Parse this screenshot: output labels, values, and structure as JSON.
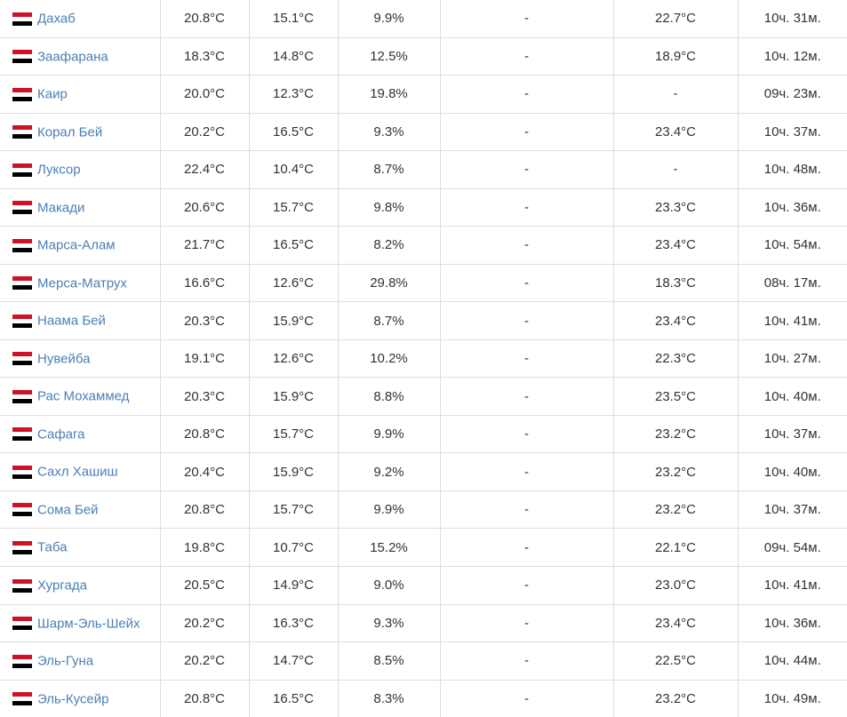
{
  "rows": [
    {
      "city": "Дахаб",
      "t1": "20.8°C",
      "t2": "15.1°C",
      "humidity": "9.9%",
      "precip": "-",
      "water": "22.7°C",
      "daylight": "10ч. 31м."
    },
    {
      "city": "Заафарана",
      "t1": "18.3°C",
      "t2": "14.8°C",
      "humidity": "12.5%",
      "precip": "-",
      "water": "18.9°C",
      "daylight": "10ч. 12м."
    },
    {
      "city": "Каир",
      "t1": "20.0°C",
      "t2": "12.3°C",
      "humidity": "19.8%",
      "precip": "-",
      "water": "-",
      "daylight": "09ч. 23м."
    },
    {
      "city": "Корал Бей",
      "t1": "20.2°C",
      "t2": "16.5°C",
      "humidity": "9.3%",
      "precip": "-",
      "water": "23.4°C",
      "daylight": "10ч. 37м."
    },
    {
      "city": "Луксор",
      "t1": "22.4°C",
      "t2": "10.4°C",
      "humidity": "8.7%",
      "precip": "-",
      "water": "-",
      "daylight": "10ч. 48м."
    },
    {
      "city": "Макади",
      "t1": "20.6°C",
      "t2": "15.7°C",
      "humidity": "9.8%",
      "precip": "-",
      "water": "23.3°C",
      "daylight": "10ч. 36м."
    },
    {
      "city": "Марса-Алам",
      "t1": "21.7°C",
      "t2": "16.5°C",
      "humidity": "8.2%",
      "precip": "-",
      "water": "23.4°C",
      "daylight": "10ч. 54м."
    },
    {
      "city": "Мерса-Матрух",
      "t1": "16.6°C",
      "t2": "12.6°C",
      "humidity": "29.8%",
      "precip": "-",
      "water": "18.3°C",
      "daylight": "08ч. 17м."
    },
    {
      "city": "Наама Бей",
      "t1": "20.3°C",
      "t2": "15.9°C",
      "humidity": "8.7%",
      "precip": "-",
      "water": "23.4°C",
      "daylight": "10ч. 41м."
    },
    {
      "city": "Нувейба",
      "t1": "19.1°C",
      "t2": "12.6°C",
      "humidity": "10.2%",
      "precip": "-",
      "water": "22.3°C",
      "daylight": "10ч. 27м."
    },
    {
      "city": "Рас Мохаммед",
      "t1": "20.3°C",
      "t2": "15.9°C",
      "humidity": "8.8%",
      "precip": "-",
      "water": "23.5°C",
      "daylight": "10ч. 40м."
    },
    {
      "city": "Сафага",
      "t1": "20.8°C",
      "t2": "15.7°C",
      "humidity": "9.9%",
      "precip": "-",
      "water": "23.2°C",
      "daylight": "10ч. 37м."
    },
    {
      "city": "Сахл Хашиш",
      "t1": "20.4°C",
      "t2": "15.9°C",
      "humidity": "9.2%",
      "precip": "-",
      "water": "23.2°C",
      "daylight": "10ч. 40м."
    },
    {
      "city": "Сома Бей",
      "t1": "20.8°C",
      "t2": "15.7°C",
      "humidity": "9.9%",
      "precip": "-",
      "water": "23.2°C",
      "daylight": "10ч. 37м."
    },
    {
      "city": "Таба",
      "t1": "19.8°C",
      "t2": "10.7°C",
      "humidity": "15.2%",
      "precip": "-",
      "water": "22.1°C",
      "daylight": "09ч. 54м."
    },
    {
      "city": "Хургада",
      "t1": "20.5°C",
      "t2": "14.9°C",
      "humidity": "9.0%",
      "precip": "-",
      "water": "23.0°C",
      "daylight": "10ч. 41м."
    },
    {
      "city": "Шарм-Эль-Шейх",
      "t1": "20.2°C",
      "t2": "16.3°C",
      "humidity": "9.3%",
      "precip": "-",
      "water": "23.4°C",
      "daylight": "10ч. 36м."
    },
    {
      "city": "Эль-Гуна",
      "t1": "20.2°C",
      "t2": "14.7°C",
      "humidity": "8.5%",
      "precip": "-",
      "water": "22.5°C",
      "daylight": "10ч. 44м."
    },
    {
      "city": "Эль-Кусейр",
      "t1": "20.8°C",
      "t2": "16.5°C",
      "humidity": "8.3%",
      "precip": "-",
      "water": "23.2°C",
      "daylight": "10ч. 49м."
    }
  ]
}
